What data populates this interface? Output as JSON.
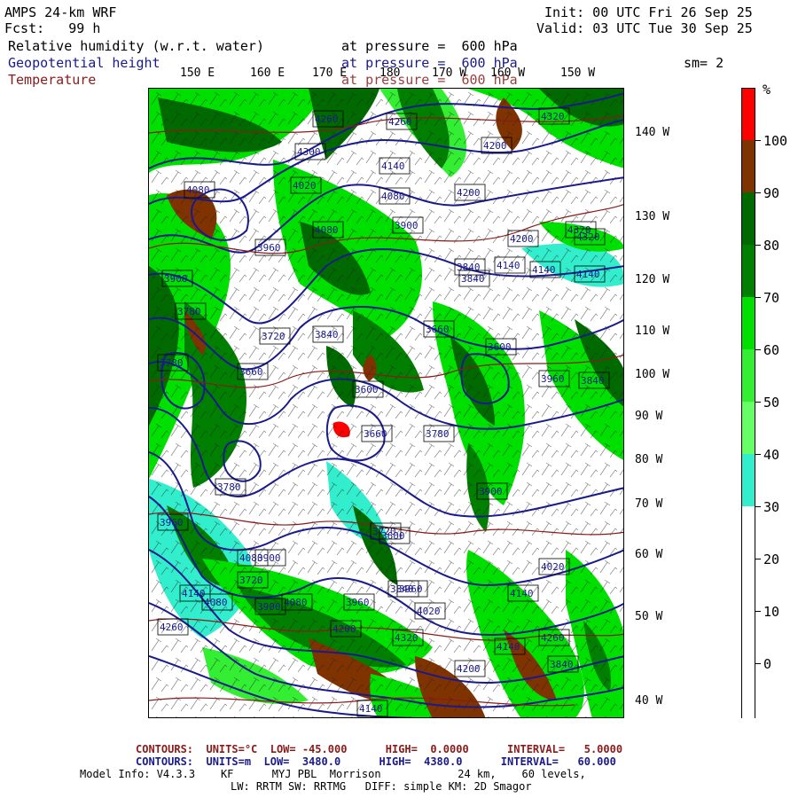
{
  "header": {
    "model": "AMPS 24-km WRF",
    "fcst": "Fcst:   99 h",
    "init": "Init: 00 UTC Fri 26 Sep 25",
    "valid": "Valid: 03 UTC Tue 30 Sep 25",
    "fields": [
      {
        "name": "Relative humidity (w.r.t. water)",
        "level": "at pressure =  600 hPa",
        "color": "#000000"
      },
      {
        "name": "Geopotential height",
        "level": "at pressure =  600 hPa",
        "color": "#1a1a8c"
      },
      {
        "name": "Temperature",
        "level": "at pressure =  600 hPa",
        "color": "#8b1a1a"
      }
    ],
    "smoothing": "sm= 2"
  },
  "longitude_labels_top": [
    "150 E",
    "160 E",
    "170 E",
    "180",
    "170 W",
    "160 W",
    "150 W"
  ],
  "longitude_labels_right": [
    "140 W",
    "130 W",
    "120 W",
    "110 W",
    "100 W",
    "90 W",
    "80 W",
    "70 W",
    "60 W",
    "50 W",
    "40 W"
  ],
  "height_contour_labels": [
    "4260",
    "4260",
    "4320",
    "4200",
    "4300",
    "4140",
    "4080",
    "4020",
    "4080",
    "4200",
    "4200",
    "4320",
    "4140",
    "3900",
    "4080",
    "3960",
    "3840",
    "4140",
    "4140",
    "3900",
    "3780",
    "3660",
    "3600",
    "3840",
    "3720",
    "3960",
    "3840",
    "3780",
    "3660",
    "3840",
    "3600",
    "3780",
    "3660",
    "3900",
    "3780",
    "3720",
    "3960",
    "4080",
    "3600",
    "3900",
    "3720",
    "3840",
    "4140",
    "4020",
    "4080",
    "3960",
    "4140",
    "4260",
    "4200",
    "4140",
    "4260",
    "4200",
    "4080",
    "3960",
    "3900",
    "4020",
    "3840",
    "4320",
    "4320",
    "4140"
  ],
  "colorbar": {
    "unit": "%",
    "labels": [
      "100",
      "90",
      "80",
      "70",
      "60",
      "50",
      "40",
      "30",
      "20",
      "10",
      "0"
    ],
    "segments": [
      {
        "range": "100+",
        "color": "#ff0000"
      },
      {
        "range": "90-100",
        "color": "#7f3300"
      },
      {
        "range": "80-90",
        "color": "#006a00"
      },
      {
        "range": "70-80",
        "color": "#007f00"
      },
      {
        "range": "60-70",
        "color": "#00e000"
      },
      {
        "range": "50-60",
        "color": "#33ee33"
      },
      {
        "range": "40-50",
        "color": "#66ff66"
      },
      {
        "range": "30-40",
        "color": "#33eecc"
      },
      {
        "range": "below 30",
        "color": "#ffffff"
      }
    ]
  },
  "footer": {
    "temp_contours": "CONTOURS:  UNITS=°C  LOW= -45.000      HIGH=  0.0000      INTERVAL=   5.0000",
    "height_contours": "CONTOURS:  UNITS=m  LOW=  3480.0      HIGH=  4380.0      INTERVAL=   60.000",
    "model_info_1": "Model Info: V4.3.3    KF      MYJ PBL  Morrison            24 km,    60 levels,",
    "model_info_2": "LW: RRTM SW: RRTMG   DIFF: simple KM: 2D Smagor"
  }
}
